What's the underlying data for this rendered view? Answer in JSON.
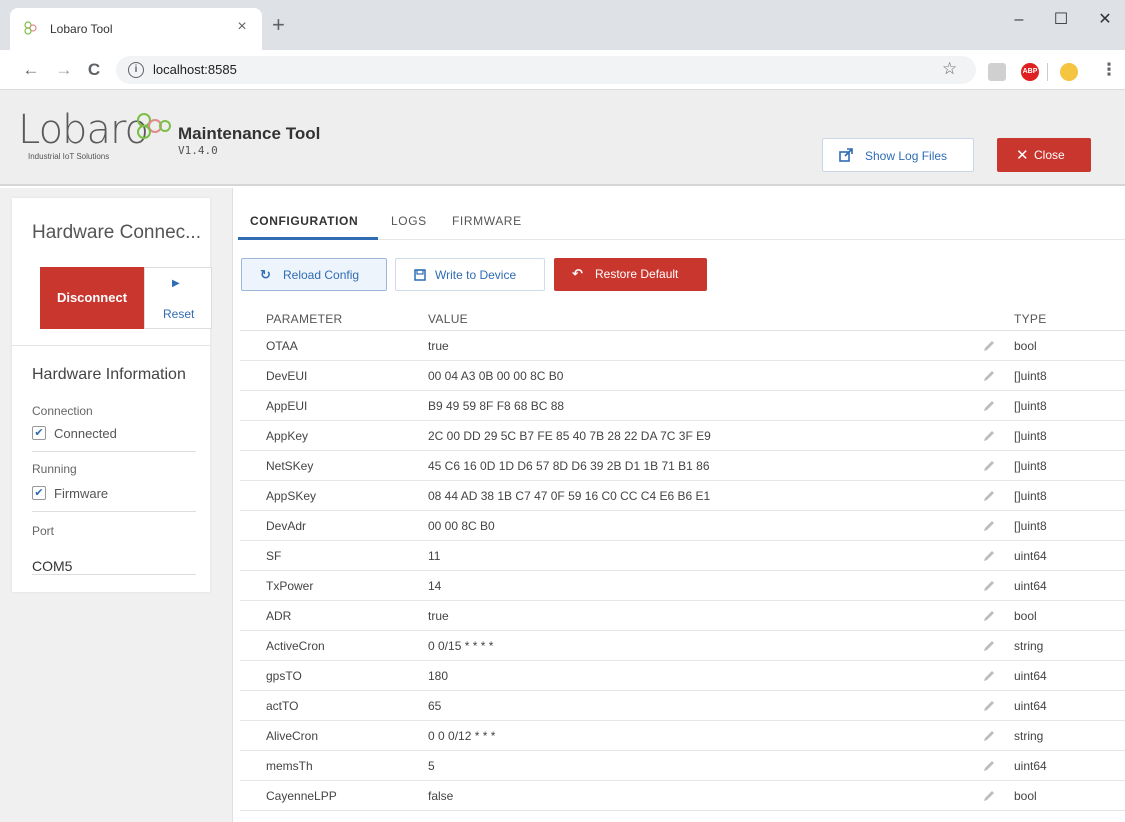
{
  "browser": {
    "tab_title": "Lobaro Tool",
    "tab_close": "×",
    "new_tab": "+",
    "window_controls": {
      "minimize": "–",
      "maximize": "☐",
      "close": "✕"
    },
    "nav": {
      "back": "←",
      "forward": "→",
      "reload": "C"
    },
    "url": "localhost:8585",
    "info_icon": "i",
    "extensions": [
      {
        "name": "pdf-extension-icon",
        "color": "#cfcfcf"
      },
      {
        "name": "adblock-icon",
        "label": "ABP",
        "color": "#e02020"
      },
      {
        "name": "emoji-extension-icon",
        "color": "#f5c542"
      }
    ],
    "menu": "⋮"
  },
  "header": {
    "logo_word": "Lobaro",
    "logo_tagline": "Industrial IoT Solutions",
    "title": "Maintenance Tool",
    "version": "V1.4.0",
    "show_logs_label": "Show Log Files",
    "close_label": "Close",
    "close_icon": "✕",
    "colors": {
      "accent": "#2f6cb3",
      "danger": "#c9362e",
      "logo_green": "#7bbf44"
    }
  },
  "sidebar": {
    "title": "Hardware Connec...",
    "disconnect_label": "Disconnect",
    "reset_label": "Reset",
    "reset_icon": "▶",
    "info_title": "Hardware Information",
    "connection_label": "Connection",
    "connection_value": "Connected",
    "running_label": "Running",
    "running_value": "Firmware",
    "port_label": "Port",
    "port_value": "COM5",
    "check_mark": "✔"
  },
  "tabs": [
    {
      "label": "CONFIGURATION",
      "active": true
    },
    {
      "label": "LOGS",
      "active": false
    },
    {
      "label": "FIRMWARE",
      "active": false
    }
  ],
  "actions": {
    "reload_label": "Reload Config",
    "reload_icon": "↻",
    "write_label": "Write to Device",
    "write_icon": "💾",
    "restore_label": "Restore Default",
    "restore_icon": "↶"
  },
  "table": {
    "headers": {
      "parameter": "PARAMETER",
      "value": "VALUE",
      "type": "TYPE"
    },
    "rows": [
      {
        "parameter": "OTAA",
        "value": "true",
        "type": "bool"
      },
      {
        "parameter": "DevEUI",
        "value": "00 04 A3 0B 00 00 8C B0",
        "type": "[]uint8"
      },
      {
        "parameter": "AppEUI",
        "value": "B9 49 59 8F F8 68 BC 88",
        "type": "[]uint8"
      },
      {
        "parameter": "AppKey",
        "value": "2C 00 DD 29 5C B7 FE 85 40 7B 28 22 DA 7C 3F E9",
        "type": "[]uint8"
      },
      {
        "parameter": "NetSKey",
        "value": "45 C6 16 0D 1D D6 57 8D D6 39 2B D1 1B 71 B1 86",
        "type": "[]uint8"
      },
      {
        "parameter": "AppSKey",
        "value": "08 44 AD 38 1B C7 47 0F 59 16 C0 CC C4 E6 B6 E1",
        "type": "[]uint8"
      },
      {
        "parameter": "DevAdr",
        "value": "00 00 8C B0",
        "type": "[]uint8"
      },
      {
        "parameter": "SF",
        "value": "11",
        "type": "uint64"
      },
      {
        "parameter": "TxPower",
        "value": "14",
        "type": "uint64"
      },
      {
        "parameter": "ADR",
        "value": "true",
        "type": "bool"
      },
      {
        "parameter": "ActiveCron",
        "value": "0 0/15 * * * *",
        "type": "string"
      },
      {
        "parameter": "gpsTO",
        "value": "180",
        "type": "uint64"
      },
      {
        "parameter": "actTO",
        "value": "65",
        "type": "uint64"
      },
      {
        "parameter": "AliveCron",
        "value": "0 0 0/12 * * *",
        "type": "string"
      },
      {
        "parameter": "memsTh",
        "value": "5",
        "type": "uint64"
      },
      {
        "parameter": "CayenneLPP",
        "value": "false",
        "type": "bool"
      }
    ]
  }
}
